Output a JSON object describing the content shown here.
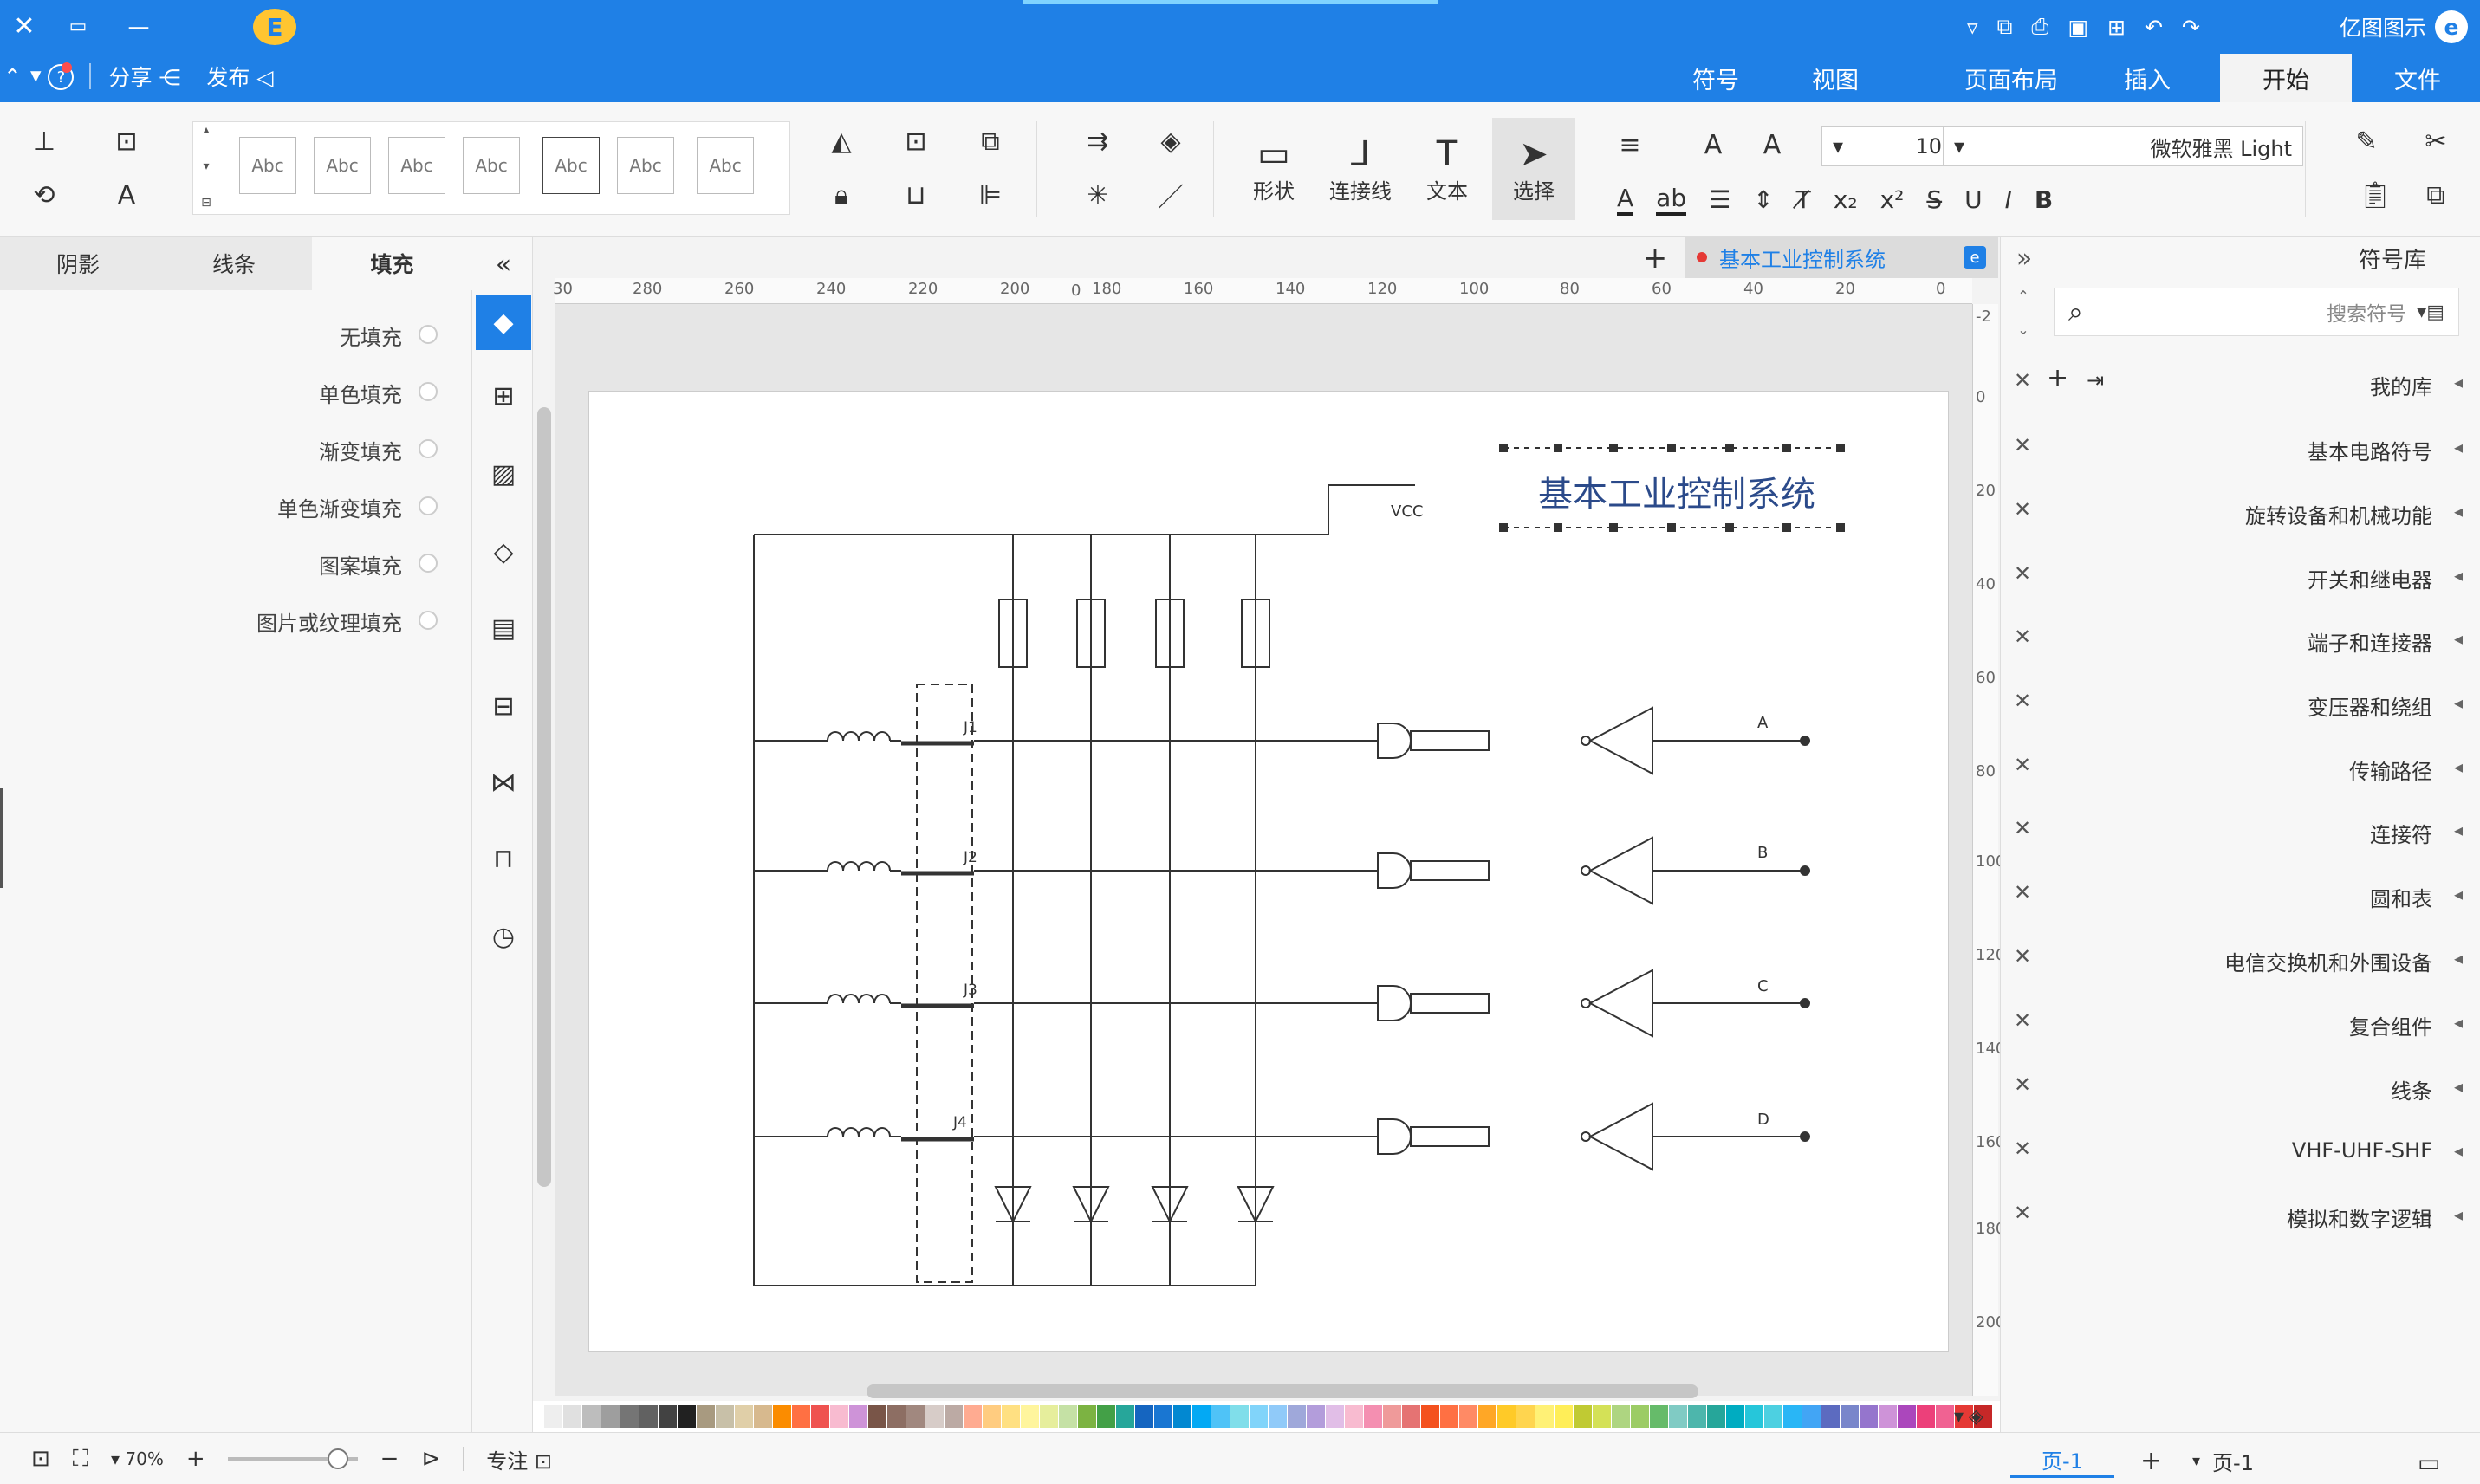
{
  "app": {
    "title": "亿图图示",
    "publish": "发布",
    "share": "分享",
    "help": "?",
    "badge_letter": "E"
  },
  "menu": {
    "tabs": [
      "文件",
      "开始",
      "插入",
      "页面布局",
      "视图",
      "符号"
    ],
    "active": "开始"
  },
  "ribbon": {
    "font_name": "微软雅黑 Light",
    "font_size": "10",
    "select_label": "选择",
    "text_label": "文本",
    "connector_label": "连接线",
    "shape_label": "形状",
    "style_sample": "Abc"
  },
  "symbol_library": {
    "title": "符号库",
    "search_placeholder": "搜索符号",
    "items": [
      "我的库",
      "基本电路符号",
      "旋转设备和机械功能",
      "开关和继电器",
      "端子和连接器",
      "变压器和绕组",
      "传输路径",
      "连接符",
      "圆和表",
      "电信交换机和外围设备",
      "复合组件",
      "线条",
      "VHF-UHF-SHF",
      "模拟和数字逻辑"
    ]
  },
  "format_panel": {
    "tabs": [
      "填充",
      "线条",
      "阴影"
    ],
    "active_tab": "填充",
    "options": [
      "无填充",
      "单色填充",
      "渐变填充",
      "单色渐变填充",
      "图案填充",
      "图片或纹理填充"
    ]
  },
  "document": {
    "tab_title": "基本工业控制系统",
    "ruler_h": [
      "0",
      "20",
      "40",
      "60",
      "80",
      "100",
      "120",
      "140",
      "160",
      "180",
      "200",
      "220",
      "240",
      "260",
      "280",
      "30"
    ],
    "ruler_v": [
      "-2",
      "0",
      "20",
      "40",
      "60",
      "80",
      "100",
      "120",
      "140",
      "160",
      "180",
      "200"
    ]
  },
  "diagram": {
    "title": "基本工业控制系统",
    "vcc": "VCC",
    "outputs": [
      "A",
      "B",
      "C",
      "D"
    ],
    "coils": [
      "J1",
      "J2",
      "J3",
      "J4"
    ]
  },
  "status": {
    "page_select": "页-1",
    "page_tab": "页-1",
    "focus": "专注",
    "zoom": "70%"
  },
  "palette": [
    "#c62828",
    "#e53935",
    "#f06292",
    "#ec407a",
    "#ab47bc",
    "#ce93d8",
    "#9575cd",
    "#7986cb",
    "#5c6bc0",
    "#42a5f5",
    "#29b6f6",
    "#4dd0e1",
    "#26c6da",
    "#00acc1",
    "#26a69a",
    "#4db6ac",
    "#80cbc4",
    "#66bb6a",
    "#9ccc65",
    "#aed581",
    "#d4e157",
    "#c0ca33",
    "#ffee58",
    "#fff176",
    "#ffd54f",
    "#ffca28",
    "#ffa726",
    "#ff8a65",
    "#ff7043",
    "#f4511e",
    "#e57373",
    "#ef9a9a",
    "#f48fb1",
    "#f8bbd0",
    "#e1bee7",
    "#b39ddb",
    "#9fa8da",
    "#90caf9",
    "#81d4fa",
    "#80deea",
    "#4fc3f7",
    "#03a9f4",
    "#0288d1",
    "#1976d2",
    "#1565c0",
    "#26a69a",
    "#43a047",
    "#7cb342",
    "#c5e1a5",
    "#e6ee9c",
    "#fff59d",
    "#ffe082",
    "#ffcc80",
    "#ffab91",
    "#bcaaa4",
    "#d7ccc8",
    "#a1887f",
    "#8d6e63",
    "#795548",
    "#ce93d8",
    "#f8bbd0",
    "#ef5350",
    "#ff7043",
    "#fb8c00",
    "#d7b98e",
    "#e0cfa8",
    "#c8c0a8",
    "#a89a80",
    "#212121",
    "#424242",
    "#616161",
    "#757575",
    "#9e9e9e",
    "#bdbdbd",
    "#e0e0e0",
    "#eeeeee"
  ]
}
